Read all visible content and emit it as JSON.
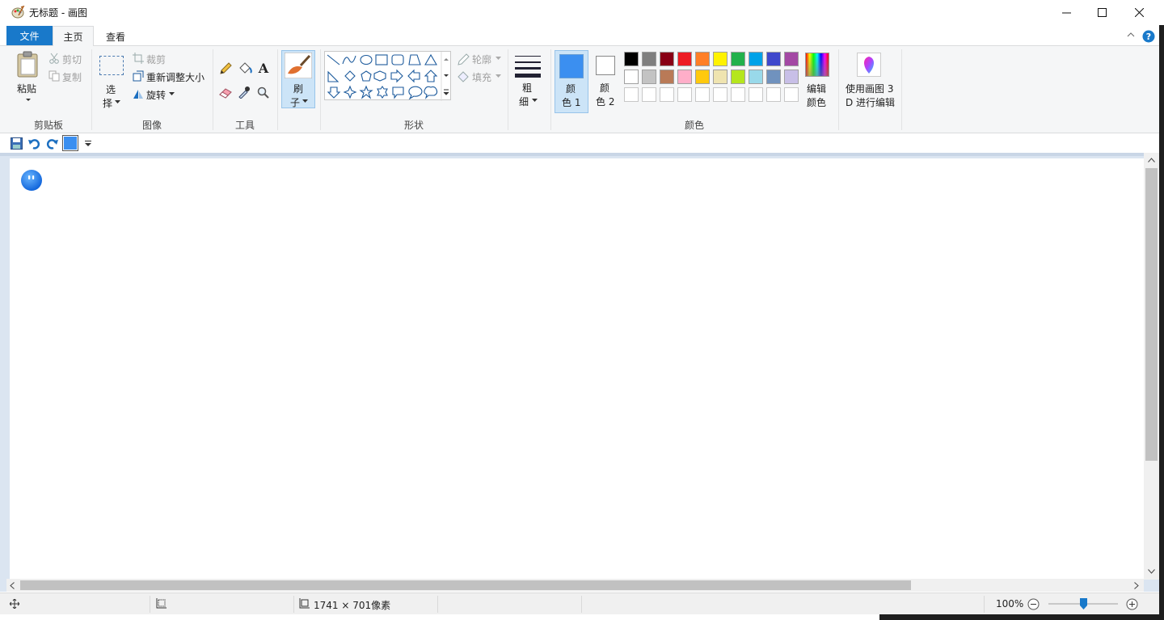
{
  "window": {
    "title": "无标题 - 画图"
  },
  "tabs": {
    "file": "文件",
    "home": "主页",
    "view": "查看"
  },
  "clipboard": {
    "paste": "粘贴",
    "cut": "剪切",
    "copy": "复制",
    "group": "剪贴板"
  },
  "image": {
    "select_line1": "选",
    "select_line2": "择",
    "crop": "裁剪",
    "resize": "重新调整大小",
    "rotate": "旋转",
    "group": "图像"
  },
  "tools": {
    "group": "工具"
  },
  "brushes": {
    "line1": "刷",
    "line2": "子"
  },
  "shapes": {
    "outline": "轮廓",
    "fill": "填充",
    "group": "形状"
  },
  "size": {
    "line1": "粗",
    "line2": "细"
  },
  "colors": {
    "color1_line1": "颜",
    "color1_line2": "色 1",
    "color2_line1": "颜",
    "color2_line2": "色 2",
    "edit_line1": "编辑",
    "edit_line2": "颜色",
    "group": "颜色",
    "color1_value": "#3b8ff0",
    "color2_value": "#ffffff",
    "palette_row1": [
      "#000000",
      "#7f7f7f",
      "#880015",
      "#ed1c24",
      "#ff7f27",
      "#fff200",
      "#22b14c",
      "#00a2e8",
      "#3f48cc",
      "#a349a4"
    ],
    "palette_row2": [
      "#ffffff",
      "#c3c3c3",
      "#b97a57",
      "#ffaec9",
      "#ffc90e",
      "#efe4b0",
      "#b5e61d",
      "#99d9ea",
      "#7092be",
      "#c8bfe7"
    ]
  },
  "paint3d": {
    "line1": "使用画图 3",
    "line2": "D 进行编辑"
  },
  "status": {
    "dimensions": "1741 × 701像素",
    "zoom": "100%",
    "zoom_level": 0.5
  }
}
